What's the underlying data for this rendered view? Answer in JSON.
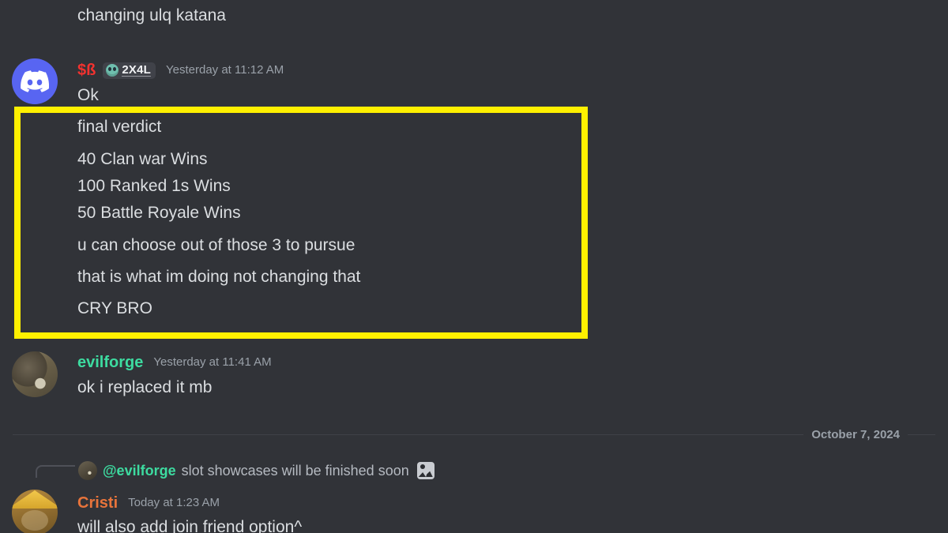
{
  "app": {
    "name": "Discord",
    "theme": "dark",
    "background_color": "#313338"
  },
  "colors": {
    "background": "#313338",
    "text_primary": "#dbdee1",
    "text_muted": "#9aa1a9",
    "username_red": "#f2322f",
    "username_green": "#3ddba0",
    "username_orange": "#e8743b",
    "highlight_yellow": "#fff000",
    "discord_blurple": "#5865f2",
    "divider": "#3f4147"
  },
  "messages": {
    "top_partial": {
      "text": "changing ulq katana"
    },
    "group_sb": {
      "avatar_name": "discord-logo-avatar",
      "username": "$ß",
      "badge": {
        "emoji_name": "skull-emoji",
        "label": "2X4L"
      },
      "timestamp": "Yesterday at 11:12 AM",
      "lines": [
        "Ok"
      ]
    },
    "highlighted": {
      "lines": [
        "final verdict",
        "40 Clan war Wins",
        "100 Ranked 1s Wins",
        "50 Battle Royale Wins",
        "u can choose out of those 3 to pursue",
        "that is what im doing not changing that",
        "CRY BRO"
      ]
    },
    "group_evilforge": {
      "avatar_name": "evilforge-avatar",
      "username": "evilforge",
      "timestamp": "Yesterday at 11:41 AM",
      "lines": [
        "ok i replaced it mb"
      ]
    },
    "date_divider": {
      "label": "October 7, 2024"
    },
    "group_cristi": {
      "reply": {
        "mention": "@evilforge",
        "text": "slot showcases will be finished soon",
        "attachment_emoji_name": "image-emoji"
      },
      "avatar_name": "cristi-avatar",
      "username": "Cristi",
      "timestamp": "Today at 1:23 AM",
      "lines": [
        "will also add join friend option^"
      ]
    }
  }
}
